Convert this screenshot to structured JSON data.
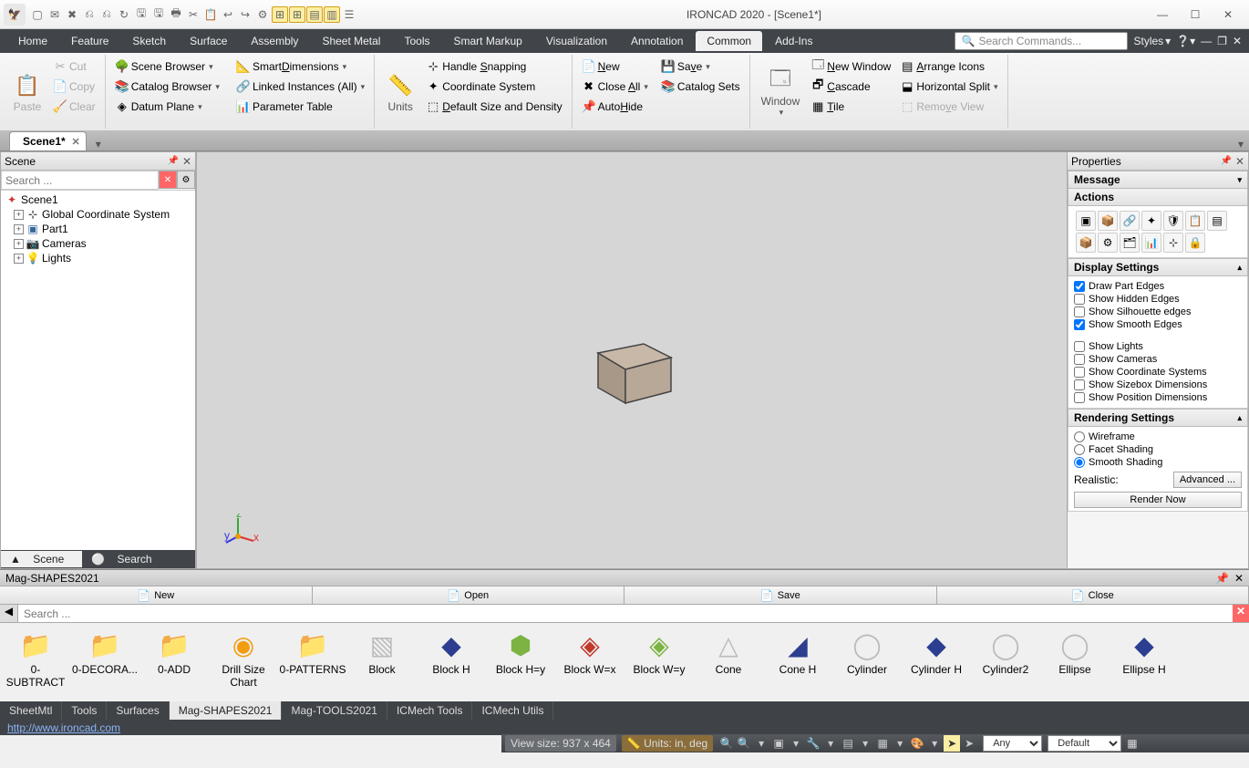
{
  "title": "IRONCAD 2020 - [Scene1*]",
  "qat": [
    "▢",
    "✉",
    "✖",
    "⎌",
    "⎌",
    "↻",
    "🖫",
    "🖫",
    "🖶",
    "✂",
    "📋",
    "↩",
    "↪",
    "⚙",
    "⊞",
    "⊞",
    "▤",
    "▥",
    "☰"
  ],
  "menus": [
    "Home",
    "Feature",
    "Sketch",
    "Surface",
    "Assembly",
    "Sheet Metal",
    "Tools",
    "Smart Markup",
    "Visualization",
    "Annotation",
    "Common",
    "Add-Ins"
  ],
  "activeMenu": "Common",
  "searchPH": "Search Commands...",
  "styles": "Styles",
  "ribbon": {
    "paste": {
      "label": "Paste",
      "cut": "Cut",
      "copy": "Copy",
      "clear": "Clear"
    },
    "g1": [
      "Scene Browser",
      "Catalog Browser",
      "Datum Plane"
    ],
    "g1b": [
      "SmartDimensions",
      "Linked Instances (All)",
      "Parameter Table"
    ],
    "units": "Units",
    "g2": [
      "Handle Snapping",
      "Coordinate System",
      "Default Size and Density"
    ],
    "g3": [
      "New",
      "Close All",
      "AutoHide"
    ],
    "g3b": [
      "Save",
      "Catalog Sets"
    ],
    "window": "Window",
    "g4": [
      "New Window",
      "Cascade",
      "Tile"
    ],
    "g4b": [
      "Arrange Icons",
      "Horizontal Split",
      "Remove View"
    ]
  },
  "docTab": "Scene1*",
  "scene": {
    "title": "Scene",
    "searchPH": "Search ...",
    "items": [
      "Scene1",
      "Global Coordinate System",
      "Part1",
      "Cameras",
      "Lights"
    ],
    "footScene": "Scene",
    "footSearch": "Search"
  },
  "props": {
    "title": "Properties",
    "msg": "Message",
    "actions": "Actions",
    "disp": "Display Settings",
    "dispItems": [
      [
        "Draw Part Edges",
        true
      ],
      [
        "Show Hidden Edges",
        false
      ],
      [
        "Show Silhouette edges",
        false
      ],
      [
        "Show Smooth Edges",
        true
      ],
      [
        "",
        null
      ],
      [
        "Show Lights",
        false
      ],
      [
        "Show Cameras",
        false
      ],
      [
        "Show Coordinate Systems",
        false
      ],
      [
        "Show Sizebox Dimensions",
        false
      ],
      [
        "Show Position Dimensions",
        false
      ]
    ],
    "rend": "Rendering Settings",
    "rendOpts": [
      "Wireframe",
      "Facet Shading",
      "Smooth Shading"
    ],
    "rendSel": "Smooth Shading",
    "realistic": "Realistic:",
    "adv": "Advanced ...",
    "renderNow": "Render Now"
  },
  "catalog": {
    "title": "Mag-SHAPES2021",
    "ops": [
      "New",
      "Open",
      "Save",
      "Close"
    ],
    "searchPH": "Search ...",
    "items": [
      [
        "0-SUBTRACT",
        "📁",
        "#e74c3c"
      ],
      [
        "0-DECORA...",
        "📁",
        "#3498db"
      ],
      [
        "0-ADD",
        "📁",
        "#7cb342"
      ],
      [
        "Drill Size Chart",
        "◉",
        "#f39c12"
      ],
      [
        "0-PATTERNS",
        "📁",
        "#3498db"
      ],
      [
        "Block",
        "▧",
        "#bbb"
      ],
      [
        "Block H",
        "◆",
        "#2c3e8f"
      ],
      [
        "Block H=y",
        "⬢",
        "#7cb342"
      ],
      [
        "Block W=x",
        "◈",
        "#c0392b"
      ],
      [
        "Block W=y",
        "◈",
        "#7cb342"
      ],
      [
        "Cone",
        "△",
        "#bbb"
      ],
      [
        "Cone H",
        "◢",
        "#2c3e8f"
      ],
      [
        "Cylinder",
        "◯",
        "#bbb"
      ],
      [
        "Cylinder H",
        "◆",
        "#2c3e8f"
      ],
      [
        "Cylinder2",
        "◯",
        "#bbb"
      ],
      [
        "Ellipse",
        "◯",
        "#bbb"
      ],
      [
        "Ellipse H",
        "◆",
        "#2c3e8f"
      ]
    ]
  },
  "botTabs": [
    "SheetMtl",
    "Tools",
    "Surfaces",
    "Mag-SHAPES2021",
    "Mag-TOOLS2021",
    "ICMech Tools",
    "ICMech Utils"
  ],
  "botActive": "Mag-SHAPES2021",
  "status": {
    "url": "http://www.ironcad.com",
    "viewSize": "View size:  937 x  464",
    "units": "Units:    in, deg",
    "dd1": "Any",
    "dd2": "Default"
  }
}
